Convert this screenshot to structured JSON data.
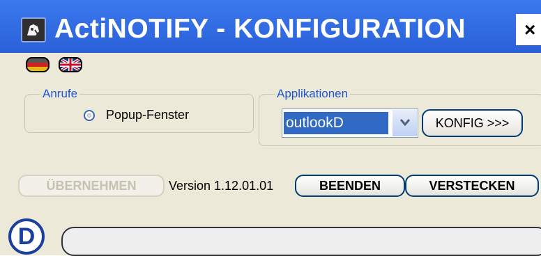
{
  "window": {
    "title": "ActiNOTIFY - KONFIGURATION",
    "close_label": "×",
    "title_bar_color": "#2f68e0"
  },
  "language_flags": [
    {
      "name": "german-flag"
    },
    {
      "name": "uk-flag"
    }
  ],
  "anrufe": {
    "legend": "Anrufe",
    "popup_label": "Popup-Fenster"
  },
  "applikationen": {
    "legend": "Applikationen",
    "selected": "outlookD",
    "konfig_label": "KONFIG >>>"
  },
  "bottom": {
    "uebernehmen_label": "ÜBERNEHMEN",
    "version_text": "Version 1.12.01.01",
    "beenden_label": "BEENDEN",
    "verstecken_label": "VERSTECKEN"
  },
  "status": {
    "icon_letter": "D",
    "field_value": ""
  }
}
